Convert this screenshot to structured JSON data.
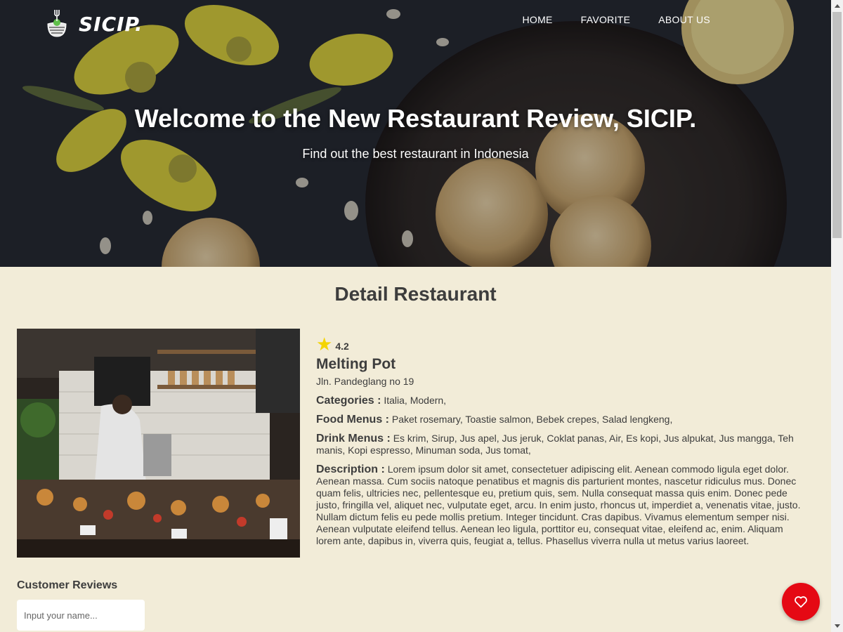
{
  "brand": {
    "name": "SICIP."
  },
  "nav": {
    "items": [
      "HOME",
      "FAVORITE",
      "ABOUT US"
    ]
  },
  "hero": {
    "title": "Welcome to the New Restaurant Review, SICIP.",
    "subtitle": "Find out the best restaurant in Indonesia"
  },
  "detail": {
    "section_title": "Detail Restaurant",
    "rating": "4.2",
    "name": "Melting Pot",
    "address": "Jln. Pandeglang no 19",
    "categories_label": "Categories :",
    "categories": "Italia, Modern,",
    "food_label": "Food Menus :",
    "food": "Paket rosemary, Toastie salmon, Bebek crepes, Salad lengkeng,",
    "drink_label": "Drink Menus :",
    "drink": "Es krim, Sirup, Jus apel, Jus jeruk, Coklat panas, Air, Es kopi, Jus alpukat, Jus mangga, Teh manis, Kopi espresso, Minuman soda, Jus tomat,",
    "description_label": "Description :",
    "description": "Lorem ipsum dolor sit amet, consectetuer adipiscing elit. Aenean commodo ligula eget dolor. Aenean massa. Cum sociis natoque penatibus et magnis dis parturient montes, nascetur ridiculus mus. Donec quam felis, ultricies nec, pellentesque eu, pretium quis, sem. Nulla consequat massa quis enim. Donec pede justo, fringilla vel, aliquet nec, vulputate eget, arcu. In enim justo, rhoncus ut, imperdiet a, venenatis vitae, justo. Nullam dictum felis eu pede mollis pretium. Integer tincidunt. Cras dapibus. Vivamus elementum semper nisi. Aenean vulputate eleifend tellus. Aenean leo ligula, porttitor eu, consequat vitae, eleifend ac, enim. Aliquam lorem ante, dapibus in, viverra quis, feugiat a, tellus. Phasellus viverra nulla ut metus varius laoreet."
  },
  "reviews": {
    "title": "Customer Reviews",
    "name_placeholder": "Input your name..."
  },
  "icons": {
    "logo": "fork-bowl-logo-icon",
    "rating": "star-icon",
    "favorite": "heart-icon"
  },
  "colors": {
    "background": "#f2ecd8",
    "text": "#3d3d3d",
    "star": "#f4d400",
    "favorite_button": "#e50914"
  }
}
